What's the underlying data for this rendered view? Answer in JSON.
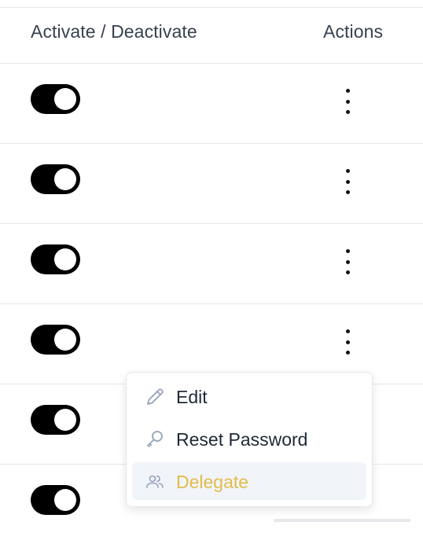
{
  "table": {
    "headers": {
      "activate": "Activate / Deactivate",
      "actions": "Actions"
    },
    "rows": [
      {
        "active": true
      },
      {
        "active": true
      },
      {
        "active": true
      },
      {
        "active": true
      },
      {
        "active": true
      },
      {
        "active": true
      }
    ]
  },
  "context_menu": {
    "items": [
      {
        "label": "Edit",
        "icon": "pencil-icon"
      },
      {
        "label": "Reset Password",
        "icon": "key-icon"
      },
      {
        "label": "Delegate",
        "icon": "users-icon",
        "highlighted": true
      }
    ],
    "highlight_text_color": "#e2bb48",
    "highlight_background": "#f1f4f9"
  },
  "colors": {
    "toggle_on": "#000000",
    "divider": "#e5e7eb"
  }
}
